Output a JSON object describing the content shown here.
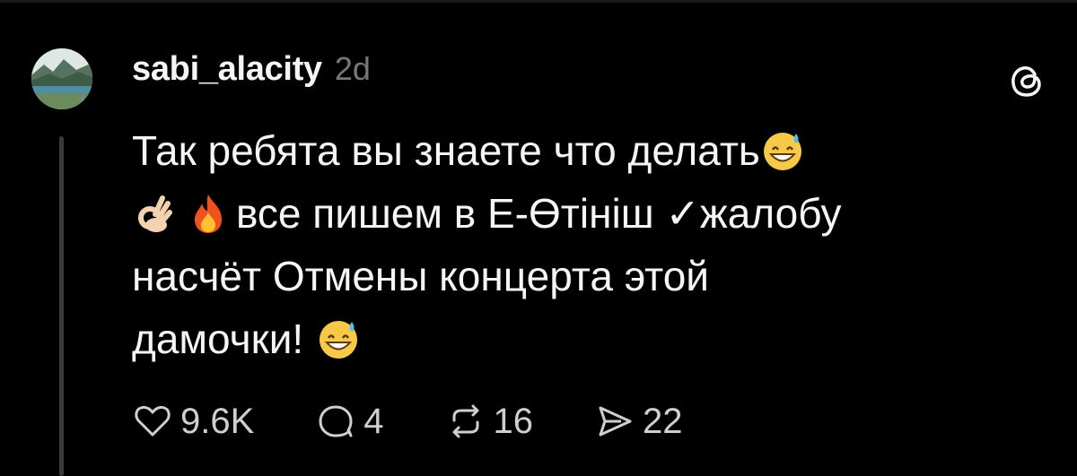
{
  "post": {
    "username": "sabi_alacity",
    "timestamp": "2d",
    "lines": [
      {
        "text": "Так ребята вы знаете что делать",
        "emoji_after": "grinning-sweat-emoji"
      },
      {
        "emoji_before": [
          "ok-hand-emoji",
          "fire-emoji"
        ],
        "text": "все пишем в Е-Өтініш ✓жалобу"
      },
      {
        "text": "насчёт Отмены концерта этой"
      },
      {
        "text": "дамочки! ",
        "emoji_after": "grinning-sweat-emoji"
      }
    ],
    "line1": "Так ребята вы знаете что делать",
    "line2": "все пишем в Е-Өтініш ✓жалобу",
    "line3": "насчёт Отмены концерта этой",
    "line4": "дамочки!"
  },
  "actions": {
    "likes": "9.6K",
    "replies": "4",
    "reposts": "16",
    "shares": "22"
  },
  "icons": {
    "like": "heart-icon",
    "reply": "comment-icon",
    "repost": "repost-icon",
    "share": "send-icon",
    "app": "threads-logo-icon"
  },
  "colors": {
    "background": "#000000",
    "text": "#f3f5f7",
    "muted": "#777777",
    "thread_line": "#3a3a3a"
  }
}
